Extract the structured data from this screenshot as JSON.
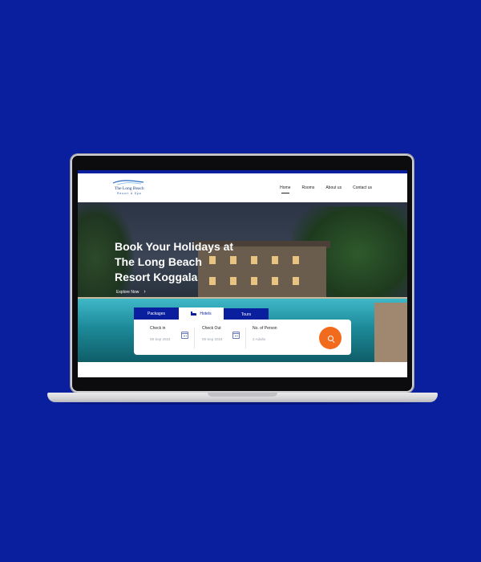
{
  "brand": {
    "name": "The Long Beach",
    "subtitle": "Resort & Spa"
  },
  "nav": {
    "items": [
      {
        "label": "Home",
        "active": true
      },
      {
        "label": "Rooms",
        "active": false
      },
      {
        "label": "About us",
        "active": false
      },
      {
        "label": "Contact us",
        "active": false
      }
    ]
  },
  "hero": {
    "title_lines": [
      "Book Your Holidays at",
      "The Long Beach",
      "Resort Koggala"
    ],
    "cta": "Explore Now"
  },
  "booking": {
    "tabs": [
      {
        "label": "Packages",
        "active": false
      },
      {
        "label": "Hotels",
        "active": true,
        "icon": "bed-icon"
      },
      {
        "label": "Tours",
        "active": false
      }
    ],
    "check_in": {
      "label": "Check in",
      "value": "08 Sep 2024"
    },
    "check_out": {
      "label": "Check Out",
      "value": "09 Sep 2024"
    },
    "persons": {
      "label": "No. of Person",
      "value": "2 Adults"
    },
    "search_icon": "search-icon"
  },
  "colors": {
    "background": "#0a1f9e",
    "accent": "#f26a1b",
    "tab_active_text": "#0a1f9e"
  }
}
